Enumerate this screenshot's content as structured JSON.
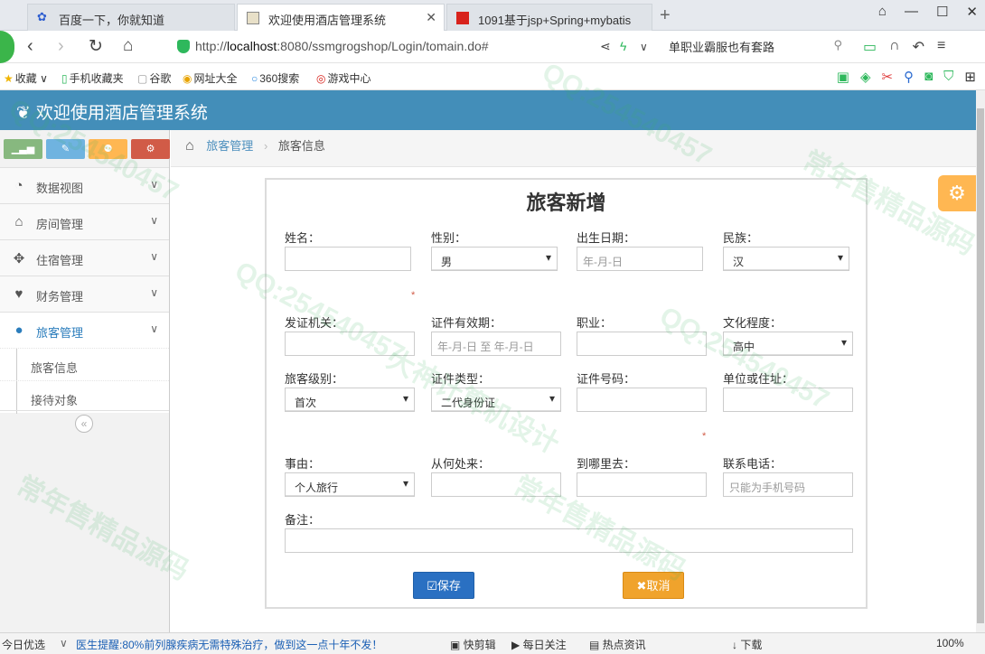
{
  "browser": {
    "tabs": [
      {
        "title": "百度一下，你就知道"
      },
      {
        "title": "欢迎使用酒店管理系统"
      },
      {
        "title": "1091基于jsp+Spring+mybatis"
      }
    ],
    "url_prefix": "http://",
    "url_host": "localhost",
    "url_rest": ":8080/ssmgrogshop/Login/tomain.do#",
    "search_text": "单职业霸服也有套路",
    "bookmarks": [
      "收藏",
      "手机收藏夹",
      "谷歌",
      "网址大全",
      "360搜索",
      "游戏中心"
    ]
  },
  "app": {
    "title": "欢迎使用酒店管理系统",
    "accent": "#438eb9"
  },
  "sidebar": {
    "shortcut_colors": [
      "#87b87f",
      "#6fb3e0",
      "#ffb752",
      "#d15b47"
    ],
    "items": [
      {
        "label": "数据视图",
        "icon": "dashboard-icon"
      },
      {
        "label": "房间管理",
        "icon": "home-icon"
      },
      {
        "label": "住宿管理",
        "icon": "move-icon"
      },
      {
        "label": "财务管理",
        "icon": "heart-icon"
      },
      {
        "label": "旅客管理",
        "icon": "user-icon"
      }
    ],
    "subitems": [
      {
        "label": "旅客信息"
      },
      {
        "label": "接待对象"
      }
    ],
    "collapse_glyph": "«"
  },
  "breadcrumbs": {
    "parent": "旅客管理",
    "current": "旅客信息"
  },
  "form": {
    "title": "旅客新增",
    "name": {
      "label": "姓名：",
      "value": ""
    },
    "gender": {
      "label": "性别：",
      "value": "男"
    },
    "birth": {
      "label": "出生日期：",
      "placeholder": "年-月-日"
    },
    "ethnic": {
      "label": "民族：",
      "value": "汉"
    },
    "issuer": {
      "label": "发证机关：",
      "value": ""
    },
    "validity": {
      "label": "证件有效期：",
      "placeholder": "年-月-日 至 年-月-日"
    },
    "job": {
      "label": "职业：",
      "value": ""
    },
    "education": {
      "label": "文化程度：",
      "value": "高中"
    },
    "level": {
      "label": "旅客级别：",
      "value": "首次"
    },
    "idtype": {
      "label": "证件类型：",
      "value": "二代身份证"
    },
    "idnum": {
      "label": "证件号码：",
      "value": ""
    },
    "address": {
      "label": "单位或住址：",
      "value": ""
    },
    "reason": {
      "label": "事由：",
      "value": "个人旅行"
    },
    "from": {
      "label": "从何处来：",
      "value": ""
    },
    "to": {
      "label": "到哪里去：",
      "value": ""
    },
    "phone": {
      "label": "联系电话：",
      "placeholder": "只能为手机号码"
    },
    "remark": {
      "label": "备注：",
      "value": ""
    },
    "required_mark": "*",
    "save_label": "保存",
    "cancel_label": "取消"
  },
  "statusbar": {
    "left": "今日优选",
    "news": "医生提醒:80%前列腺疾病无需特殊治疗，做到这一点十年不发！",
    "items": [
      "快剪辑",
      "每日关注",
      "热点资讯",
      "下载"
    ],
    "zoom": "100%"
  },
  "watermark": {
    "qq": "QQ:254540457",
    "line1": "常年售精品源码",
    "line2": "大神计算机设计"
  }
}
